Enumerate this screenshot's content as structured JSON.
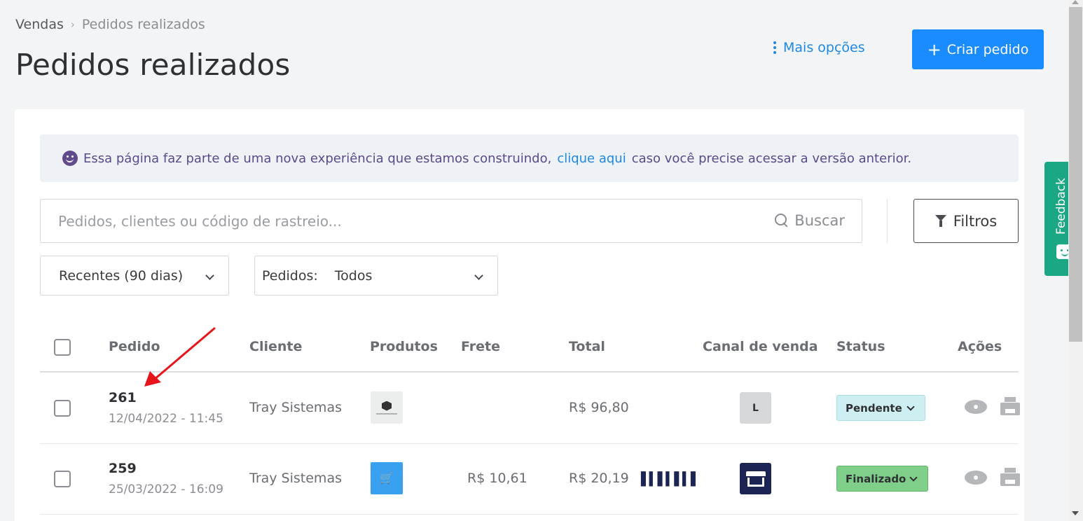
{
  "breadcrumb": {
    "parent": "Vendas",
    "separator": "›",
    "current": "Pedidos realizados"
  },
  "page": {
    "title": "Pedidos realizados"
  },
  "header": {
    "more_options": "Mais opções",
    "create_button": "Criar pedido",
    "create_icon": "+"
  },
  "notice": {
    "text_before": "Essa página faz parte de uma nova experiência que estamos construindo,",
    "link": "clique aqui",
    "text_after": "caso você precise acessar a versão anterior."
  },
  "search": {
    "placeholder": "Pedidos, clientes ou código de rastreio...",
    "button": "Buscar"
  },
  "filters": {
    "label": "Filtros"
  },
  "period_select": {
    "value": "Recentes (90 dias)"
  },
  "orders_select": {
    "label": "Pedidos:",
    "value": "Todos"
  },
  "table": {
    "columns": [
      "Pedido",
      "Cliente",
      "Produtos",
      "Frete",
      "Total",
      "Canal de venda",
      "Status",
      "Ações"
    ],
    "rows": [
      {
        "number": "261",
        "date": "12/04/2022 - 11:45",
        "client": "Tray Sistemas",
        "shipping": "",
        "total": "R$ 96,80",
        "channel": "L",
        "status": "Pendente",
        "status_color": "#cdeff2"
      },
      {
        "number": "259",
        "date": "25/03/2022 - 16:09",
        "client": "Tray Sistemas",
        "shipping": "R$ 10,61",
        "total": "R$ 20,19",
        "channel": "store-icon",
        "status": "Finalizado",
        "status_color": "#7fcf8a"
      }
    ]
  },
  "feedback": {
    "label": "Feedback"
  },
  "colors": {
    "primary": "#1a8cff",
    "link": "#1e88e5",
    "feedback": "#1aa884",
    "annotation_arrow": "#e8141c"
  }
}
